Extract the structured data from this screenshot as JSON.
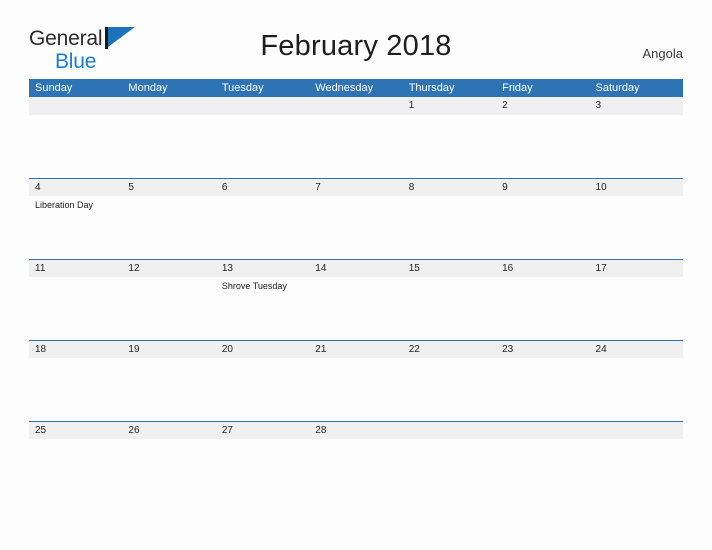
{
  "brand": {
    "word1": "General",
    "word2": "Blue",
    "flag_icon": "flag-icon",
    "color_dark": "#1a1a1a",
    "color_blue": "#1a7fd4"
  },
  "header": {
    "title": "February 2018",
    "country": "Angola",
    "accent_color": "#2e73b4"
  },
  "calendar": {
    "weekdays": [
      "Sunday",
      "Monday",
      "Tuesday",
      "Wednesday",
      "Thursday",
      "Friday",
      "Saturday"
    ],
    "weeks": [
      {
        "days": [
          {
            "date": "",
            "event": ""
          },
          {
            "date": "",
            "event": ""
          },
          {
            "date": "",
            "event": ""
          },
          {
            "date": "",
            "event": ""
          },
          {
            "date": "1",
            "event": ""
          },
          {
            "date": "2",
            "event": ""
          },
          {
            "date": "3",
            "event": ""
          }
        ]
      },
      {
        "days": [
          {
            "date": "4",
            "event": "Liberation Day"
          },
          {
            "date": "5",
            "event": ""
          },
          {
            "date": "6",
            "event": ""
          },
          {
            "date": "7",
            "event": ""
          },
          {
            "date": "8",
            "event": ""
          },
          {
            "date": "9",
            "event": ""
          },
          {
            "date": "10",
            "event": ""
          }
        ]
      },
      {
        "days": [
          {
            "date": "11",
            "event": ""
          },
          {
            "date": "12",
            "event": ""
          },
          {
            "date": "13",
            "event": "Shrove Tuesday"
          },
          {
            "date": "14",
            "event": ""
          },
          {
            "date": "15",
            "event": ""
          },
          {
            "date": "16",
            "event": ""
          },
          {
            "date": "17",
            "event": ""
          }
        ]
      },
      {
        "days": [
          {
            "date": "18",
            "event": ""
          },
          {
            "date": "19",
            "event": ""
          },
          {
            "date": "20",
            "event": ""
          },
          {
            "date": "21",
            "event": ""
          },
          {
            "date": "22",
            "event": ""
          },
          {
            "date": "23",
            "event": ""
          },
          {
            "date": "24",
            "event": ""
          }
        ]
      },
      {
        "days": [
          {
            "date": "25",
            "event": ""
          },
          {
            "date": "26",
            "event": ""
          },
          {
            "date": "27",
            "event": ""
          },
          {
            "date": "28",
            "event": ""
          },
          {
            "date": "",
            "event": ""
          },
          {
            "date": "",
            "event": ""
          },
          {
            "date": "",
            "event": ""
          }
        ]
      }
    ]
  }
}
